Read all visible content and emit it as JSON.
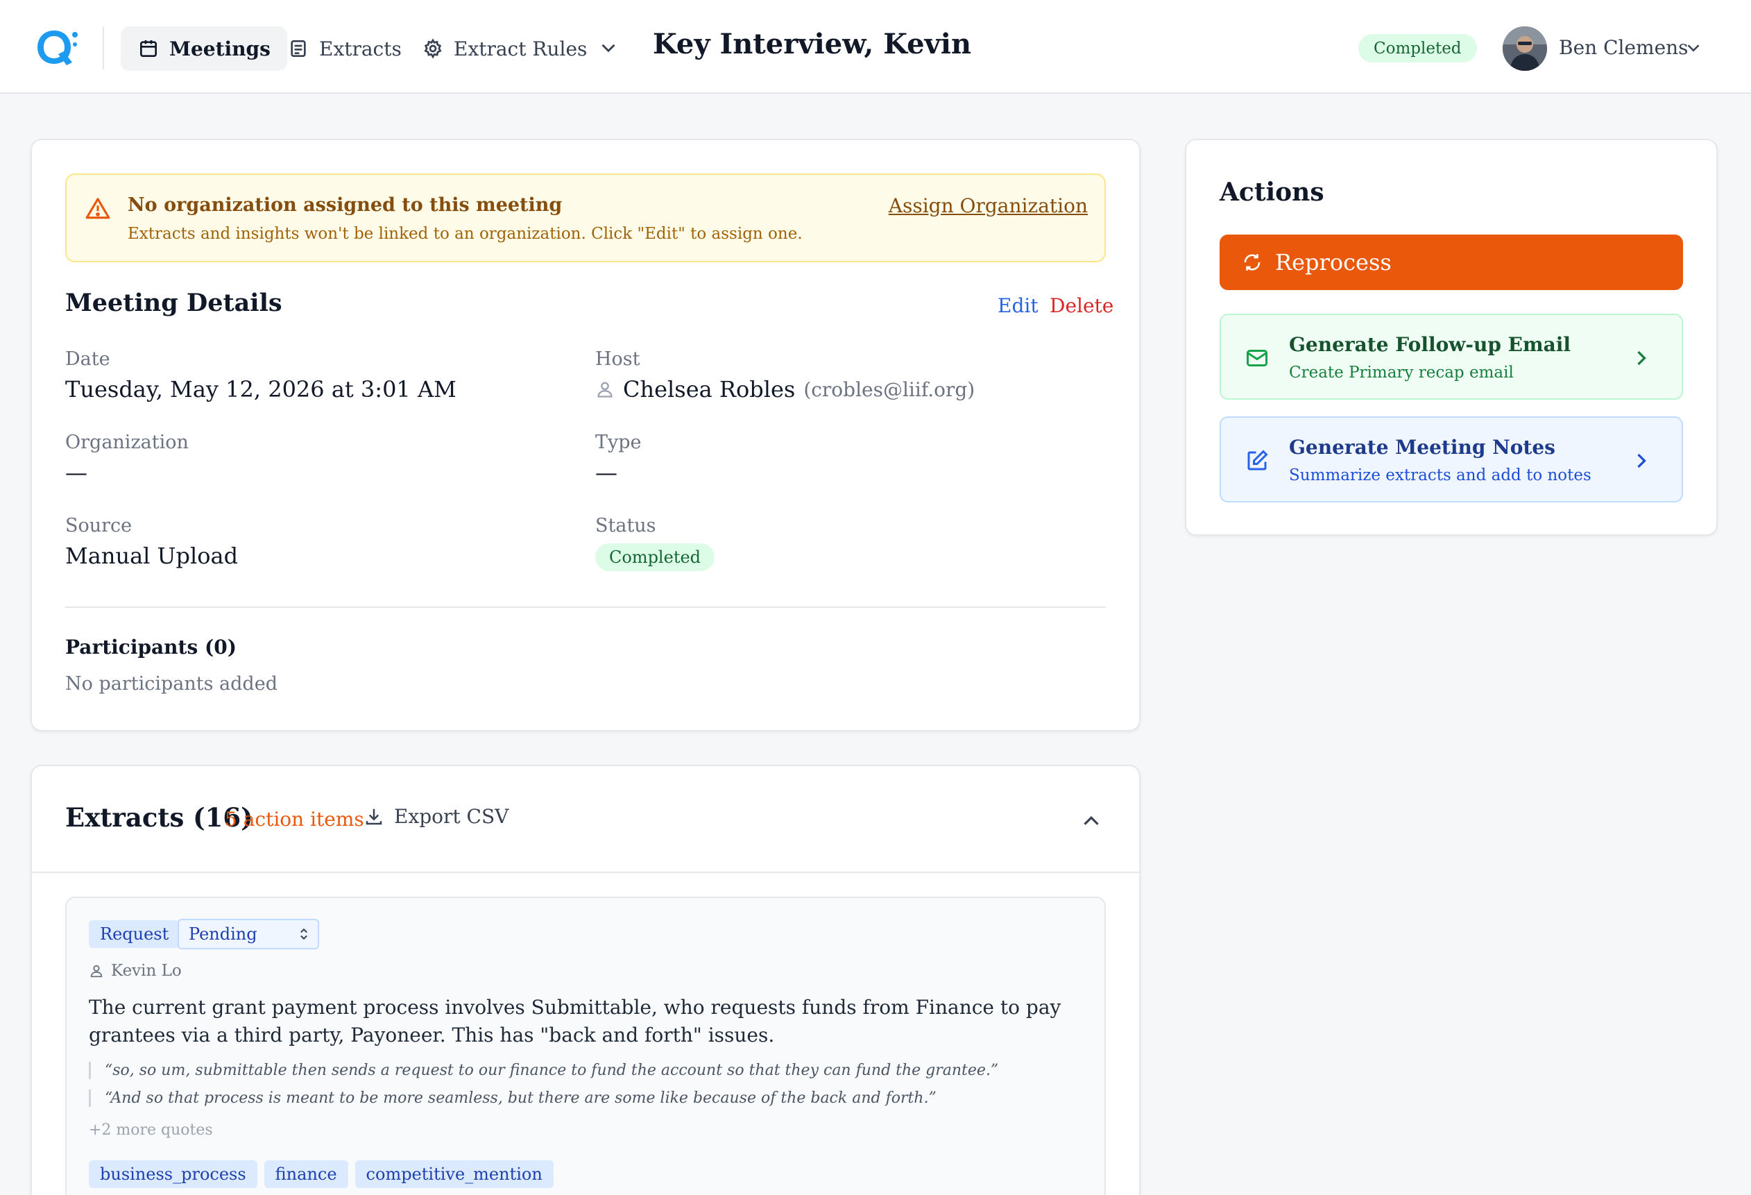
{
  "nav": {
    "items": [
      {
        "label": "Meetings",
        "icon": "calendar-icon",
        "active": true
      },
      {
        "label": "Extracts",
        "icon": "document-icon",
        "active": false
      },
      {
        "label": "Extract Rules",
        "icon": "gear-icon",
        "active": false
      }
    ],
    "more_icon": "chevron-down-icon"
  },
  "header": {
    "title": "Key Interview, Kevin",
    "status": "Completed",
    "user": {
      "name": "Ben Clemens",
      "avatar_icon": "avatar"
    }
  },
  "warning": {
    "icon": "warning-triangle-icon",
    "title": "No organization assigned to this meeting",
    "text": "Extracts and insights won't be linked to an organization. Click \"Edit\" to assign one.",
    "link": "Assign Organization"
  },
  "details": {
    "title": "Meeting Details",
    "edit_label": "Edit",
    "delete_label": "Delete",
    "date_label": "Date",
    "date_value": "Tuesday, May 12, 2026 at 3:01 AM",
    "host_label": "Host",
    "host_name": "Chelsea Robles",
    "host_email": "(crobles@liif.org)",
    "organization_label": "Organization",
    "organization_value": "—",
    "type_label": "Type",
    "type_value": "—",
    "source_label": "Source",
    "source_value": "Manual Upload",
    "status_label": "Status",
    "status_value": "Completed",
    "participants_title": "Participants (0)",
    "participants_empty": "No participants added"
  },
  "actions": {
    "title": "Actions",
    "reprocess_label": "Reprocess",
    "email": {
      "title": "Generate Follow-up Email",
      "subtitle": "Create Primary recap email"
    },
    "notes": {
      "title": "Generate Meeting Notes",
      "subtitle": "Summarize extracts and add to notes"
    }
  },
  "extracts": {
    "title": "Extracts (16)",
    "action_items": "5 action items",
    "export_label": "Export CSV",
    "items": [
      {
        "type": "Request",
        "status": "Pending",
        "speaker": "Kevin Lo",
        "summary": "The current grant payment process involves Submittable, who requests funds from Finance to pay grantees via a third party, Payoneer. This has \"back and forth\" issues.",
        "quotes": [
          "“so, so um, submittable then sends a request to our finance to fund the account so that they can fund the grantee.”",
          "“And so that process is meant to be more seamless, but there are some like because of the back and forth.”"
        ],
        "more_quotes": "+2 more quotes",
        "tags": [
          "business_process",
          "finance",
          "competitive_mention"
        ]
      }
    ]
  },
  "colors": {
    "accent": "#ea580c",
    "brand": "#1d9bf0",
    "success_bg": "#dcfce7",
    "success_text": "#166534",
    "link_blue": "#2563eb",
    "danger": "#dc2626",
    "warning_bg": "#fefce8"
  }
}
